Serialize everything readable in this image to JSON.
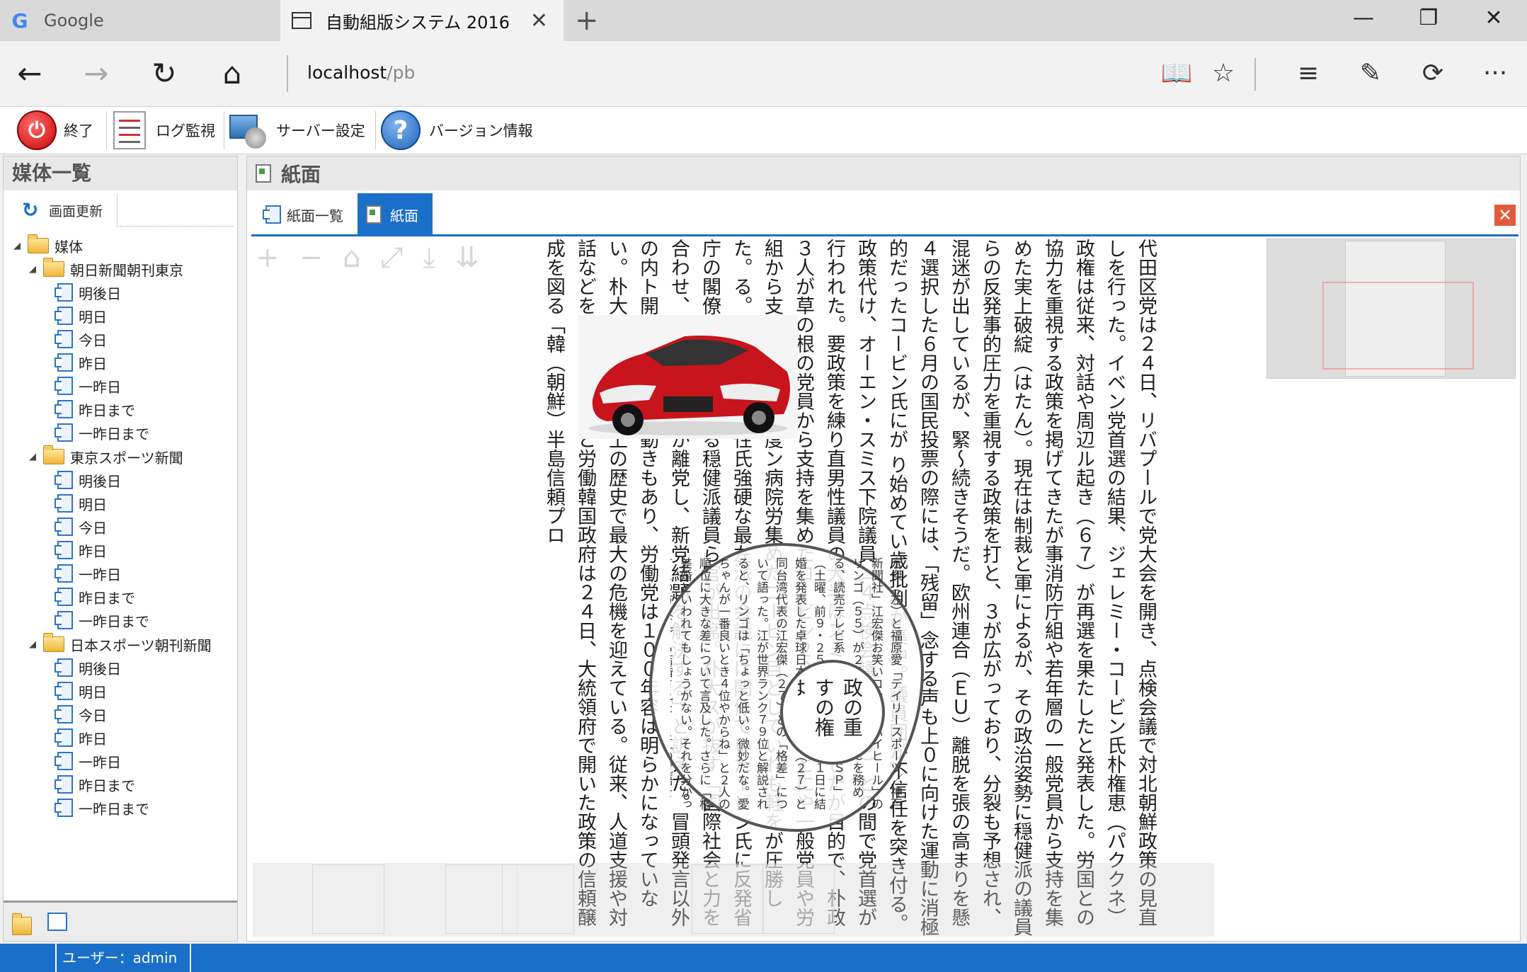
{
  "browser": {
    "tabs": [
      {
        "label": "Google",
        "active": false
      },
      {
        "label": "自動組版システム 2016",
        "active": true
      }
    ],
    "new_tab": "+",
    "window_controls": {
      "minimize": "—",
      "restore": "❐",
      "close": "✕"
    },
    "nav": {
      "back": "←",
      "forward": "→",
      "reload": "↻",
      "home": "⌂"
    },
    "address": {
      "host": "localhost",
      "path": "/pb"
    },
    "right_icons": [
      "reading-view-icon",
      "favorite-star-icon",
      "hub-icon",
      "web-note-icon",
      "share-icon",
      "more-icon"
    ],
    "right_glyphs": {
      "reading": "📖",
      "star": "☆",
      "hub": "≡",
      "note": "✎",
      "share": "⟳",
      "more": "···"
    }
  },
  "toolbar": {
    "exit_label": "終了",
    "log_label": "ログ監視",
    "server_label": "サーバー設定",
    "version_label": "バージョン情報"
  },
  "left_panel": {
    "title": "媒体一覧",
    "refresh_label": "画面更新",
    "tree": {
      "root": "媒体",
      "groups": [
        {
          "name": "朝日新聞朝刊東京",
          "items": [
            "明後日",
            "明日",
            "今日",
            "昨日",
            "一昨日",
            "昨日まで",
            "一昨日まで"
          ]
        },
        {
          "name": "東京スポーツ新聞",
          "items": [
            "明後日",
            "明日",
            "今日",
            "昨日",
            "一昨日",
            "昨日まで",
            "一昨日まで"
          ]
        },
        {
          "name": "日本スポーツ朝刊新聞",
          "items": [
            "明後日",
            "明日",
            "今日",
            "昨日",
            "一昨日",
            "昨日まで",
            "一昨日まで"
          ]
        }
      ]
    }
  },
  "right_panel": {
    "title": "紙面",
    "tabs": [
      {
        "label": "紙面一覧",
        "active": false
      },
      {
        "label": "紙面",
        "active": true
      }
    ],
    "close_glyph": "✕",
    "paper": {
      "body_text": "代田区党は２４日、リバプールで党大会を開き、点検会議で対北朝鮮政策の見直しを行った。イベン党首選の結果、ジェレミー・コービン氏朴権恵（パククネ）政権は従来、対話や周辺ル起き（６７）が再選を果たしたと発表した。労国との協力を重視する政策を掲げてきたが事消防庁組や若年層の一般党員から支持を集めた実上破綻（はたん）。現在は制裁と軍によるが、その政治姿勢に穏健派の議員らの反発事的圧力を重視する政策を打と、３が広がっており、分裂も予想され、混迷が出しているが、緊～続きそうだ。欧州連合（ＥＵ）離脱を張の高まりを懸４選択した６月の国民投票の際には、「残留」念する声も上０に向けた運動に消極的だったコービン氏にが り始めてい歳批判が集中。議員団が不信任を突き付る。政策代け、オーエン・スミス下院議員（４点検会議は国の６）との間で党首選が行われた。要政策を練り直男性議員の大半はスミス氏を支持したが目的で、朴政３人が草の根の党員から支持を集めたコービン２０１３年３とにや一般党員や労組から支持月以来、２度ン病院労集めたコービン目としていれも軽をが圧勝した。る。２４日の、男性氏強硬な最左派の会議には関係ていたービン氏に反発省庁の閣僚や次フルがコる穏健派議員ら官が出席。朴大スが抜す「国際社会と力を合わせ、北核問る。主が離党し、新党結題を解決する」と訴えた。冒頭発言以外の内ト開始成を目指す動きもあり、労働党は１００年容は明らかになっていない。朴大統領はた。以上の歴史で最大の危機を迎えている。従来、人道支援や対話などを通じて北朝鮮と労働韓国政府は２４日、大統領府で開いた政策の信頼醸成を図る「韓（朝鮮）半島信頼プロ",
      "bubble_text": "宏傑（左）と福原愛「デイリースポーツ／神戸新聞社」江宏傑お笑いコンビ「ハイヒール」のリンゴ（５５）が２４日、自身がＭＣを務める、読売テレビ系「あさパラ！２時間ＳＰ」（土曜、前９・２５）に出演。今月２１日に結婚を発表した卓球日本代表の福原愛（２７）と同台湾代表の江宏傑（２７）との「格差」について語った。江が世界ランク７９位と解説されると、リンゴは「ちょっと低い。微妙だな。愛ちゃんが一番良いとき４位やからね」と２人の順位に大きな差について言及した。さらに「格差婚といわれてもしょうがない。それを分かってこの方（江）も結婚された」と江の覚悟をくみ取った。ゲストの千原せいじも「ランク７９位は）微妙じゃなくて低",
      "bubble_highlight": "政の重すの権は"
    }
  },
  "status": {
    "user_label": "ユーザー：admin"
  }
}
